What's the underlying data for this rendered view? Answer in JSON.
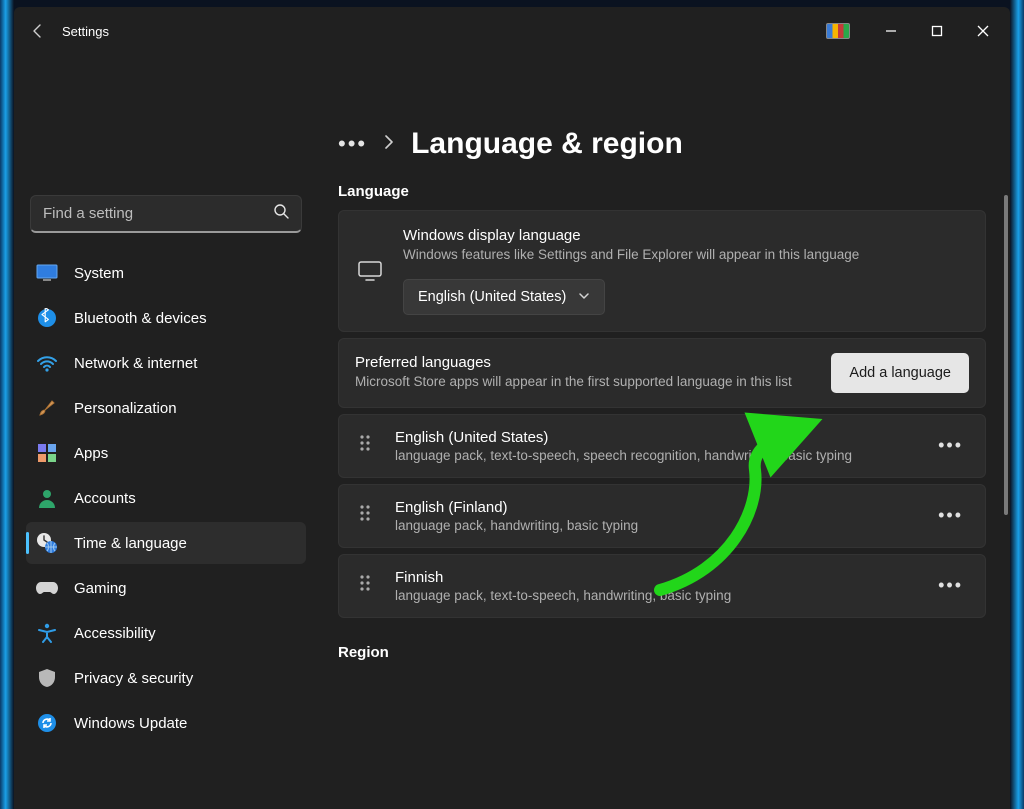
{
  "window": {
    "app_title": "Settings"
  },
  "search": {
    "placeholder": "Find a setting"
  },
  "sidebar": {
    "items": [
      {
        "label": "System"
      },
      {
        "label": "Bluetooth & devices"
      },
      {
        "label": "Network & internet"
      },
      {
        "label": "Personalization"
      },
      {
        "label": "Apps"
      },
      {
        "label": "Accounts"
      },
      {
        "label": "Time & language"
      },
      {
        "label": "Gaming"
      },
      {
        "label": "Accessibility"
      },
      {
        "label": "Privacy & security"
      },
      {
        "label": "Windows Update"
      }
    ],
    "active_index": 6
  },
  "breadcrumb": {
    "page_title": "Language & region"
  },
  "language_section": {
    "label": "Language",
    "display": {
      "title": "Windows display language",
      "subtitle": "Windows features like Settings and File Explorer will appear in this language",
      "selected": "English (United States)"
    },
    "preferred": {
      "title": "Preferred languages",
      "subtitle": "Microsoft Store apps will appear in the first supported language in this list",
      "add_button": "Add a language"
    },
    "languages": [
      {
        "name": "English (United States)",
        "detail": "language pack, text-to-speech, speech recognition, handwriting, basic typing"
      },
      {
        "name": "English (Finland)",
        "detail": "language pack, handwriting, basic typing"
      },
      {
        "name": "Finnish",
        "detail": "language pack, text-to-speech, handwriting, basic typing"
      }
    ]
  },
  "region_section": {
    "label": "Region"
  }
}
